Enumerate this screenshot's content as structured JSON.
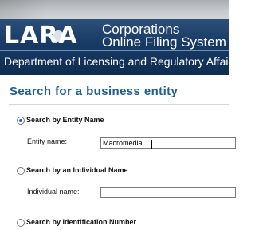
{
  "header": {
    "logo_text": "LARA",
    "system_title_line1": "Corporations",
    "system_title_line2": "Online Filing System",
    "department": "Department of Licensing and Regulatory Affairs"
  },
  "main": {
    "title": "Search for a business entity",
    "options": [
      {
        "label": "Search by Entity Name",
        "selected": true,
        "field_label": "Entity name:",
        "field_value": "Macromedia"
      },
      {
        "label": "Search by an Individual Name",
        "selected": false,
        "field_label": "Individual name:",
        "field_value": ""
      },
      {
        "label": "Search by Identification Number",
        "selected": false
      }
    ]
  },
  "colors": {
    "banner": "#173a64",
    "title": "#1f5f8f",
    "radio_selected": "#1a64c8"
  }
}
